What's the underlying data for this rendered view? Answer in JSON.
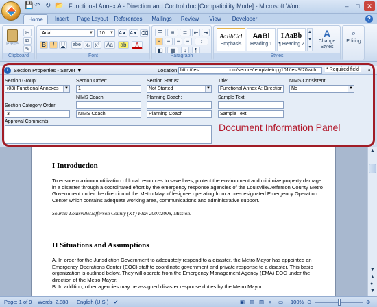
{
  "window": {
    "title": "Functional Annex A - Direction and Control.doc [Compatibility Mode] - Microsoft Word"
  },
  "tabs": [
    "Home",
    "Insert",
    "Page Layout",
    "References",
    "Mailings",
    "Review",
    "View",
    "Developer"
  ],
  "ribbon": {
    "clipboard": {
      "paste": "Paste",
      "label": "Clipboard"
    },
    "font": {
      "name": "Arial",
      "size": "10",
      "label": "Font",
      "bold": "B",
      "italic": "I",
      "underline": "U",
      "strike": "abe",
      "sub": "x₂",
      "sup": "x²",
      "aa": "Aa",
      "highlight": "ab",
      "color": "A"
    },
    "paragraph": {
      "label": "Paragraph",
      "pilcrow": "¶"
    },
    "styles": {
      "items": [
        {
          "sample": "AaBbCcI",
          "name": "Emphasis"
        },
        {
          "sample": "AaBl",
          "name": "Heading 1"
        },
        {
          "sample": "I AaBb",
          "name": "¶ Heading 2"
        }
      ],
      "change": "Change Styles",
      "label": "Styles"
    },
    "editing": {
      "label": "Editing"
    }
  },
  "dip": {
    "bar_title": "Section Properties - Server",
    "location_label": "Location:",
    "location_value_a": "http://test.",
    "location_value_b": ".com/secure/template/cpg101/test%20with",
    "required": "* Required field",
    "close": "×",
    "fields": {
      "section_group": {
        "label": "Section Group:",
        "value": "(03) Functional Annexes"
      },
      "section_order": {
        "label": "Section Order:",
        "value": "1"
      },
      "section_status": {
        "label": "Section Status:",
        "value": "Not Started"
      },
      "title": {
        "label": "Title:",
        "value": "Functional Annex A: Direction a"
      },
      "nims_consistent": {
        "label": "NIMS Consistent:",
        "value": "No"
      },
      "category_order": {
        "label": "Section Category Order:",
        "value": "3"
      },
      "nims_coach": {
        "label": "NIMS Coach:",
        "value": "NIMS Coach"
      },
      "planning_coach": {
        "label": "Planning Coach:",
        "value": "Planning Coach"
      },
      "sample_text": {
        "label": "Sample Text:",
        "value": "Sample Text"
      },
      "approval_comments": {
        "label": "Approval Comments:",
        "value": ""
      }
    },
    "annotation": "Document Information Panel"
  },
  "document": {
    "heading1": "I    Introduction",
    "para1": "To ensure maximum utilization of local resources to save lives, protect the environment and minimize property damage in a disaster through a coordinated effort by the emergency response agencies of the Louisville/Jefferson County Metro Government under the direction of the Metro Mayor/designee operating from a pre-designated Emergency Operation Center which contains adequate working area, communications and administrative support.",
    "source": "Source:  Louisville/Jefferson County (KY) Plan 2007/2008, Mission.",
    "heading2": "II  Situations and Assumptions",
    "para2a": "A. In order for the Jurisdiction Government to adequately respond to a disaster, the Metro Mayor has appointed an Emergency Operations Center (EOC) staff to coordinate government and private response to a disaster. This basic organization is outlined below. They will operate from the Emergency Management Agency (EMA) EOC under the direction of the Metro Mayor.",
    "para2b": "B. In addition, other agencies may be assigned disaster response duties by the Metro Mayor."
  },
  "status": {
    "page": "Page: 1 of 9",
    "words": "Words: 2,888",
    "language": "English (U.S.)",
    "zoom": "100%"
  }
}
